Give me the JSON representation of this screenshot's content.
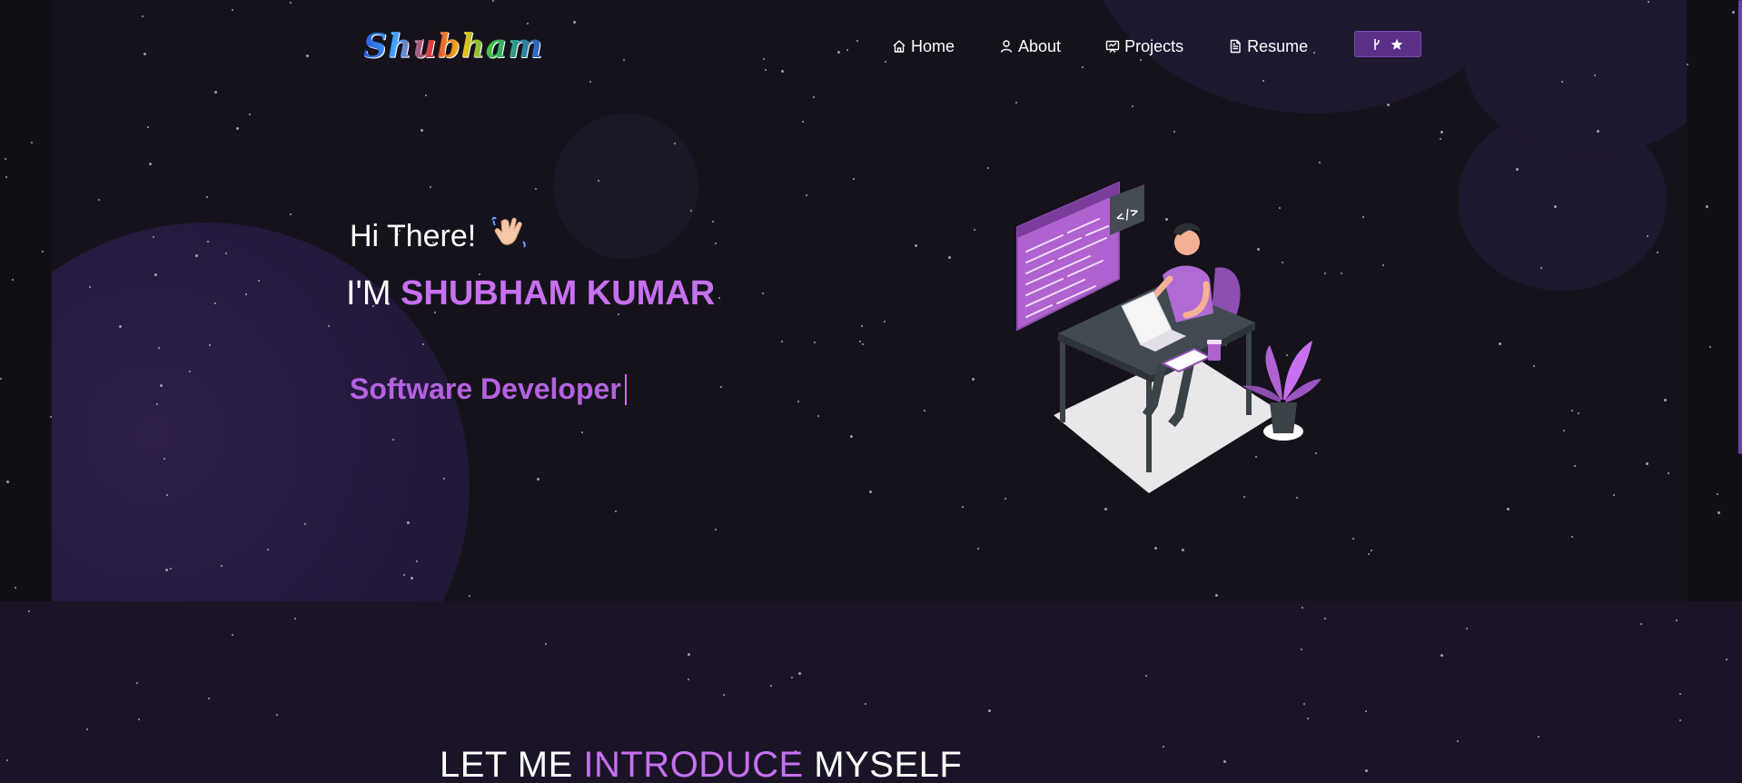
{
  "brand": {
    "logo_text": "Shubham"
  },
  "nav": {
    "items": [
      {
        "label": "Home",
        "icon": "home-icon"
      },
      {
        "label": "About",
        "icon": "user-icon"
      },
      {
        "label": "Projects",
        "icon": "projects-icon"
      },
      {
        "label": "Resume",
        "icon": "document-icon"
      }
    ],
    "fork_button": {
      "icons": [
        "git-fork-icon",
        "star-icon"
      ]
    }
  },
  "hero": {
    "greeting": "Hi There!",
    "greeting_emoji": "wave-emoji",
    "name_prefix": "I'M",
    "name": "SHUBHAM KUMAR",
    "typed_text": "Software Developer",
    "illustration": "developer-at-desk-illustration"
  },
  "intro": {
    "heading_part1": "LET ME",
    "heading_accent": "INTRODUCE",
    "heading_part2": "MYSELF"
  },
  "colors": {
    "accent": "#c770f0",
    "typed": "#b562e0",
    "background": "#15121b",
    "section_bg": "#1b1427",
    "button_bg": "#5a2f86"
  }
}
